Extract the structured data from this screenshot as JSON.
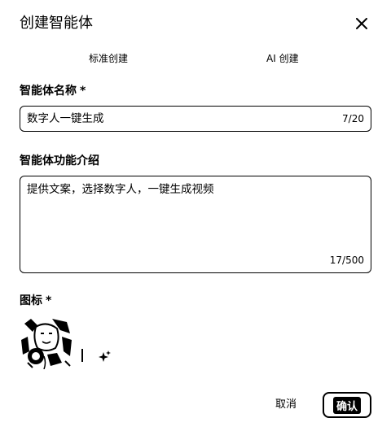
{
  "dialog": {
    "title": "创建智能体",
    "close_icon": "close-icon"
  },
  "tabs": [
    {
      "label": "标准创建"
    },
    {
      "label": "AI 创建"
    }
  ],
  "name_field": {
    "label": "智能体名称",
    "required_mark": "*",
    "value": "数字人一键生成",
    "counter": "7/20"
  },
  "desc_field": {
    "label": "智能体功能介绍",
    "value": "提供文案，选择数字人，一键生成视频",
    "counter": "17/500"
  },
  "icon_field": {
    "label": "图标",
    "required_mark": "*",
    "avatar_icon": "avatar-image",
    "generate_icon": "sparkle-icon"
  },
  "footer": {
    "cancel_label": "取消",
    "confirm_label": "确认"
  }
}
